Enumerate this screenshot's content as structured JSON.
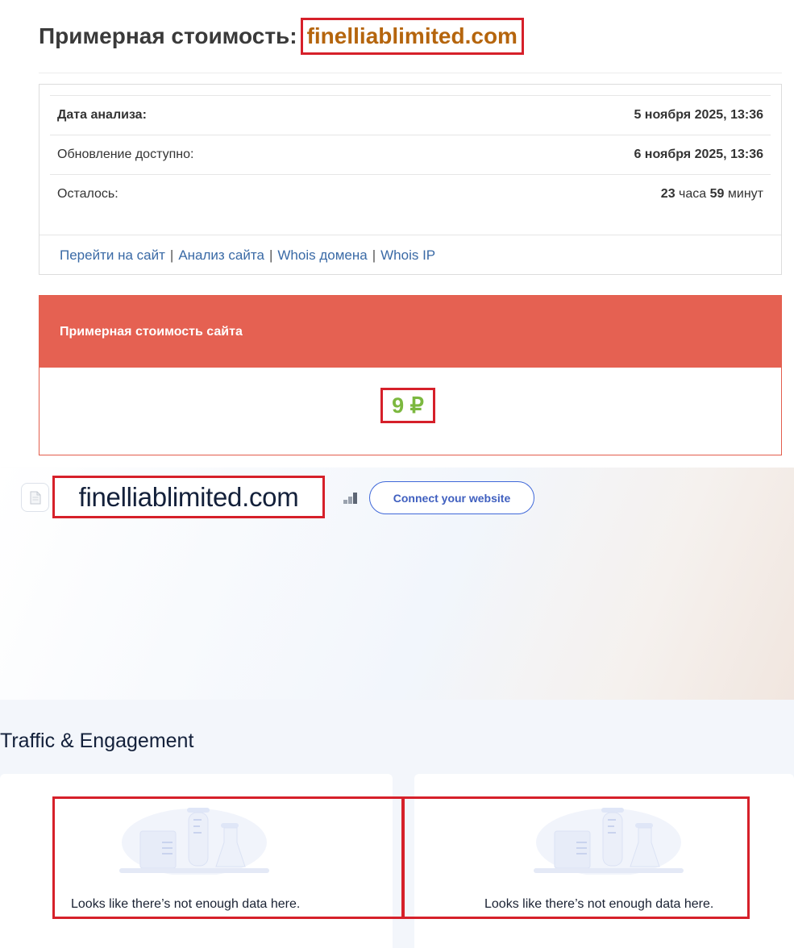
{
  "header": {
    "title": "Примерная стоимость:",
    "domain": "finelliablimited.com"
  },
  "info": {
    "rows": [
      {
        "label": "Дата анализа:",
        "value": "5 ноября 2025, 13:36"
      },
      {
        "label": "Обновление доступно:",
        "value": "6 ноября 2025, 13:36"
      }
    ],
    "remaining": {
      "label": "Осталось:",
      "hours": "23",
      "hours_unit": "часа",
      "minutes": "59",
      "minutes_unit": "минут"
    },
    "links": [
      "Перейти на сайт",
      "Анализ сайта",
      "Whois домена",
      "Whois IP"
    ],
    "separator": "|"
  },
  "price": {
    "header": "Примерная стоимость сайта",
    "value": "9 ₽"
  },
  "site": {
    "domain": "finelliablimited.com",
    "connect_label": "Connect your website",
    "favicon_icon": "page-icon",
    "rank_icon": "bar-chart-icon"
  },
  "traffic": {
    "title": "Traffic & Engagement",
    "panels": [
      {
        "empty_text": "Looks like there’s not enough data here.",
        "illustration": "lab-flasks-illustration"
      },
      {
        "empty_text": "Looks like there’s not enough data here.",
        "illustration": "lab-flasks-illustration"
      }
    ]
  },
  "colors": {
    "highlight_border": "#d6202a",
    "domain_title": "#b5650d",
    "price_header_bg": "#e56152",
    "price_value": "#7cb83f",
    "link": "#3a6aa6",
    "connect_button": "#3f68d9"
  }
}
